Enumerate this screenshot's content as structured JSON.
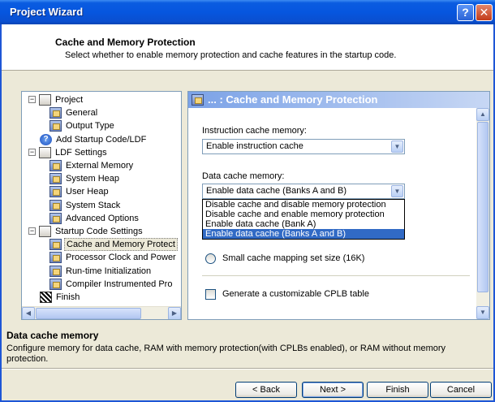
{
  "window": {
    "title": "Project Wizard",
    "help_glyph": "?",
    "close_glyph": "✕"
  },
  "header": {
    "title": "Cache and Memory Protection",
    "subtitle": "Select whether to enable memory protection and cache features in the startup code."
  },
  "tree": {
    "items": [
      {
        "label": "Project",
        "icon": "folder-icon",
        "expander": "−"
      },
      {
        "label": "General",
        "icon": "page-settings-icon"
      },
      {
        "label": "Output Type",
        "icon": "page-settings-icon"
      },
      {
        "label": "Add Startup Code/LDF",
        "icon": "help-icon"
      },
      {
        "label": "LDF Settings",
        "icon": "folder-icon",
        "expander": "−"
      },
      {
        "label": "External Memory",
        "icon": "page-settings-icon"
      },
      {
        "label": "System Heap",
        "icon": "page-settings-icon"
      },
      {
        "label": "User Heap",
        "icon": "page-settings-icon"
      },
      {
        "label": "System Stack",
        "icon": "page-settings-icon"
      },
      {
        "label": "Advanced Options",
        "icon": "page-settings-icon"
      },
      {
        "label": "Startup Code Settings",
        "icon": "folder-icon",
        "expander": "−"
      },
      {
        "label": "Cache and Memory Protect",
        "icon": "page-settings-icon"
      },
      {
        "label": "Processor Clock and Power",
        "icon": "page-settings-icon"
      },
      {
        "label": "Run-time Initialization",
        "icon": "page-settings-icon"
      },
      {
        "label": "Compiler Instrumented Pro",
        "icon": "page-settings-icon"
      },
      {
        "label": "Finish",
        "icon": "checkered-flag-icon"
      }
    ],
    "selected_index": 11
  },
  "panel": {
    "title": "... : Cache and Memory Protection",
    "instruction_label": "Instruction cache memory:",
    "instruction_value": "Enable instruction cache",
    "data_label": "Data cache memory:",
    "data_value": "Enable data cache (Banks A and B)",
    "data_options": [
      "Disable cache and disable memory protection",
      "Disable cache and enable memory protection",
      "Enable data cache (Bank A)",
      "Enable data cache (Banks A and B)"
    ],
    "data_selected_index": 3,
    "radio_label": "Small cache mapping set size (16K)",
    "checkbox_label": "Generate a customizable CPLB table"
  },
  "description": {
    "title": "Data cache memory",
    "text": "Configure memory for data cache, RAM with memory protection(with CPLBs enabled), or RAM without memory protection."
  },
  "buttons": {
    "back": "< Back",
    "next": "Next >",
    "finish": "Finish",
    "cancel": "Cancel"
  },
  "colors": {
    "titlebar": "#0656df",
    "selection": "#316ac5",
    "panel_header": "#7ba2e7"
  }
}
